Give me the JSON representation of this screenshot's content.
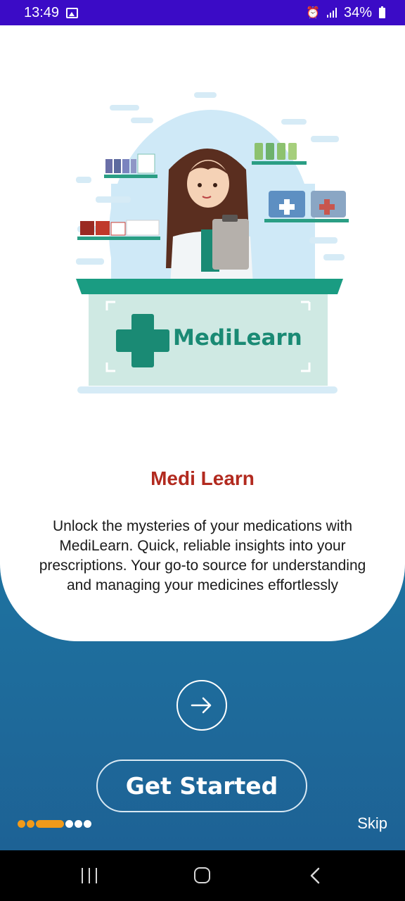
{
  "status_bar": {
    "time": "13:49",
    "battery": "34%",
    "icons": [
      "picture-icon",
      "alarm-icon",
      "signal-icon",
      "battery-icon"
    ]
  },
  "illustration": {
    "logo_text": "MediLearn"
  },
  "onboarding": {
    "title": "Medi Learn",
    "description": "Unlock the mysteries of your medications with MediLearn. Quick, reliable insights into your prescriptions. Your go-to source for understanding and managing your medicines effortlessly"
  },
  "actions": {
    "next_icon": "arrow-right-circle-icon",
    "get_started_label": "Get Started",
    "skip_label": "Skip"
  },
  "page_indicator": {
    "total_markers": 6,
    "active_index": 2
  },
  "colors": {
    "status_bar": "#3b0bc6",
    "title": "#b22a1f",
    "accent_orange": "#f19a1a",
    "brand_teal": "#1a8a74",
    "gradient_top": "#1c9bb5",
    "gradient_bottom": "#1d5f93"
  },
  "nav_bar": {
    "buttons": [
      "recents-icon",
      "home-icon",
      "back-icon"
    ]
  }
}
